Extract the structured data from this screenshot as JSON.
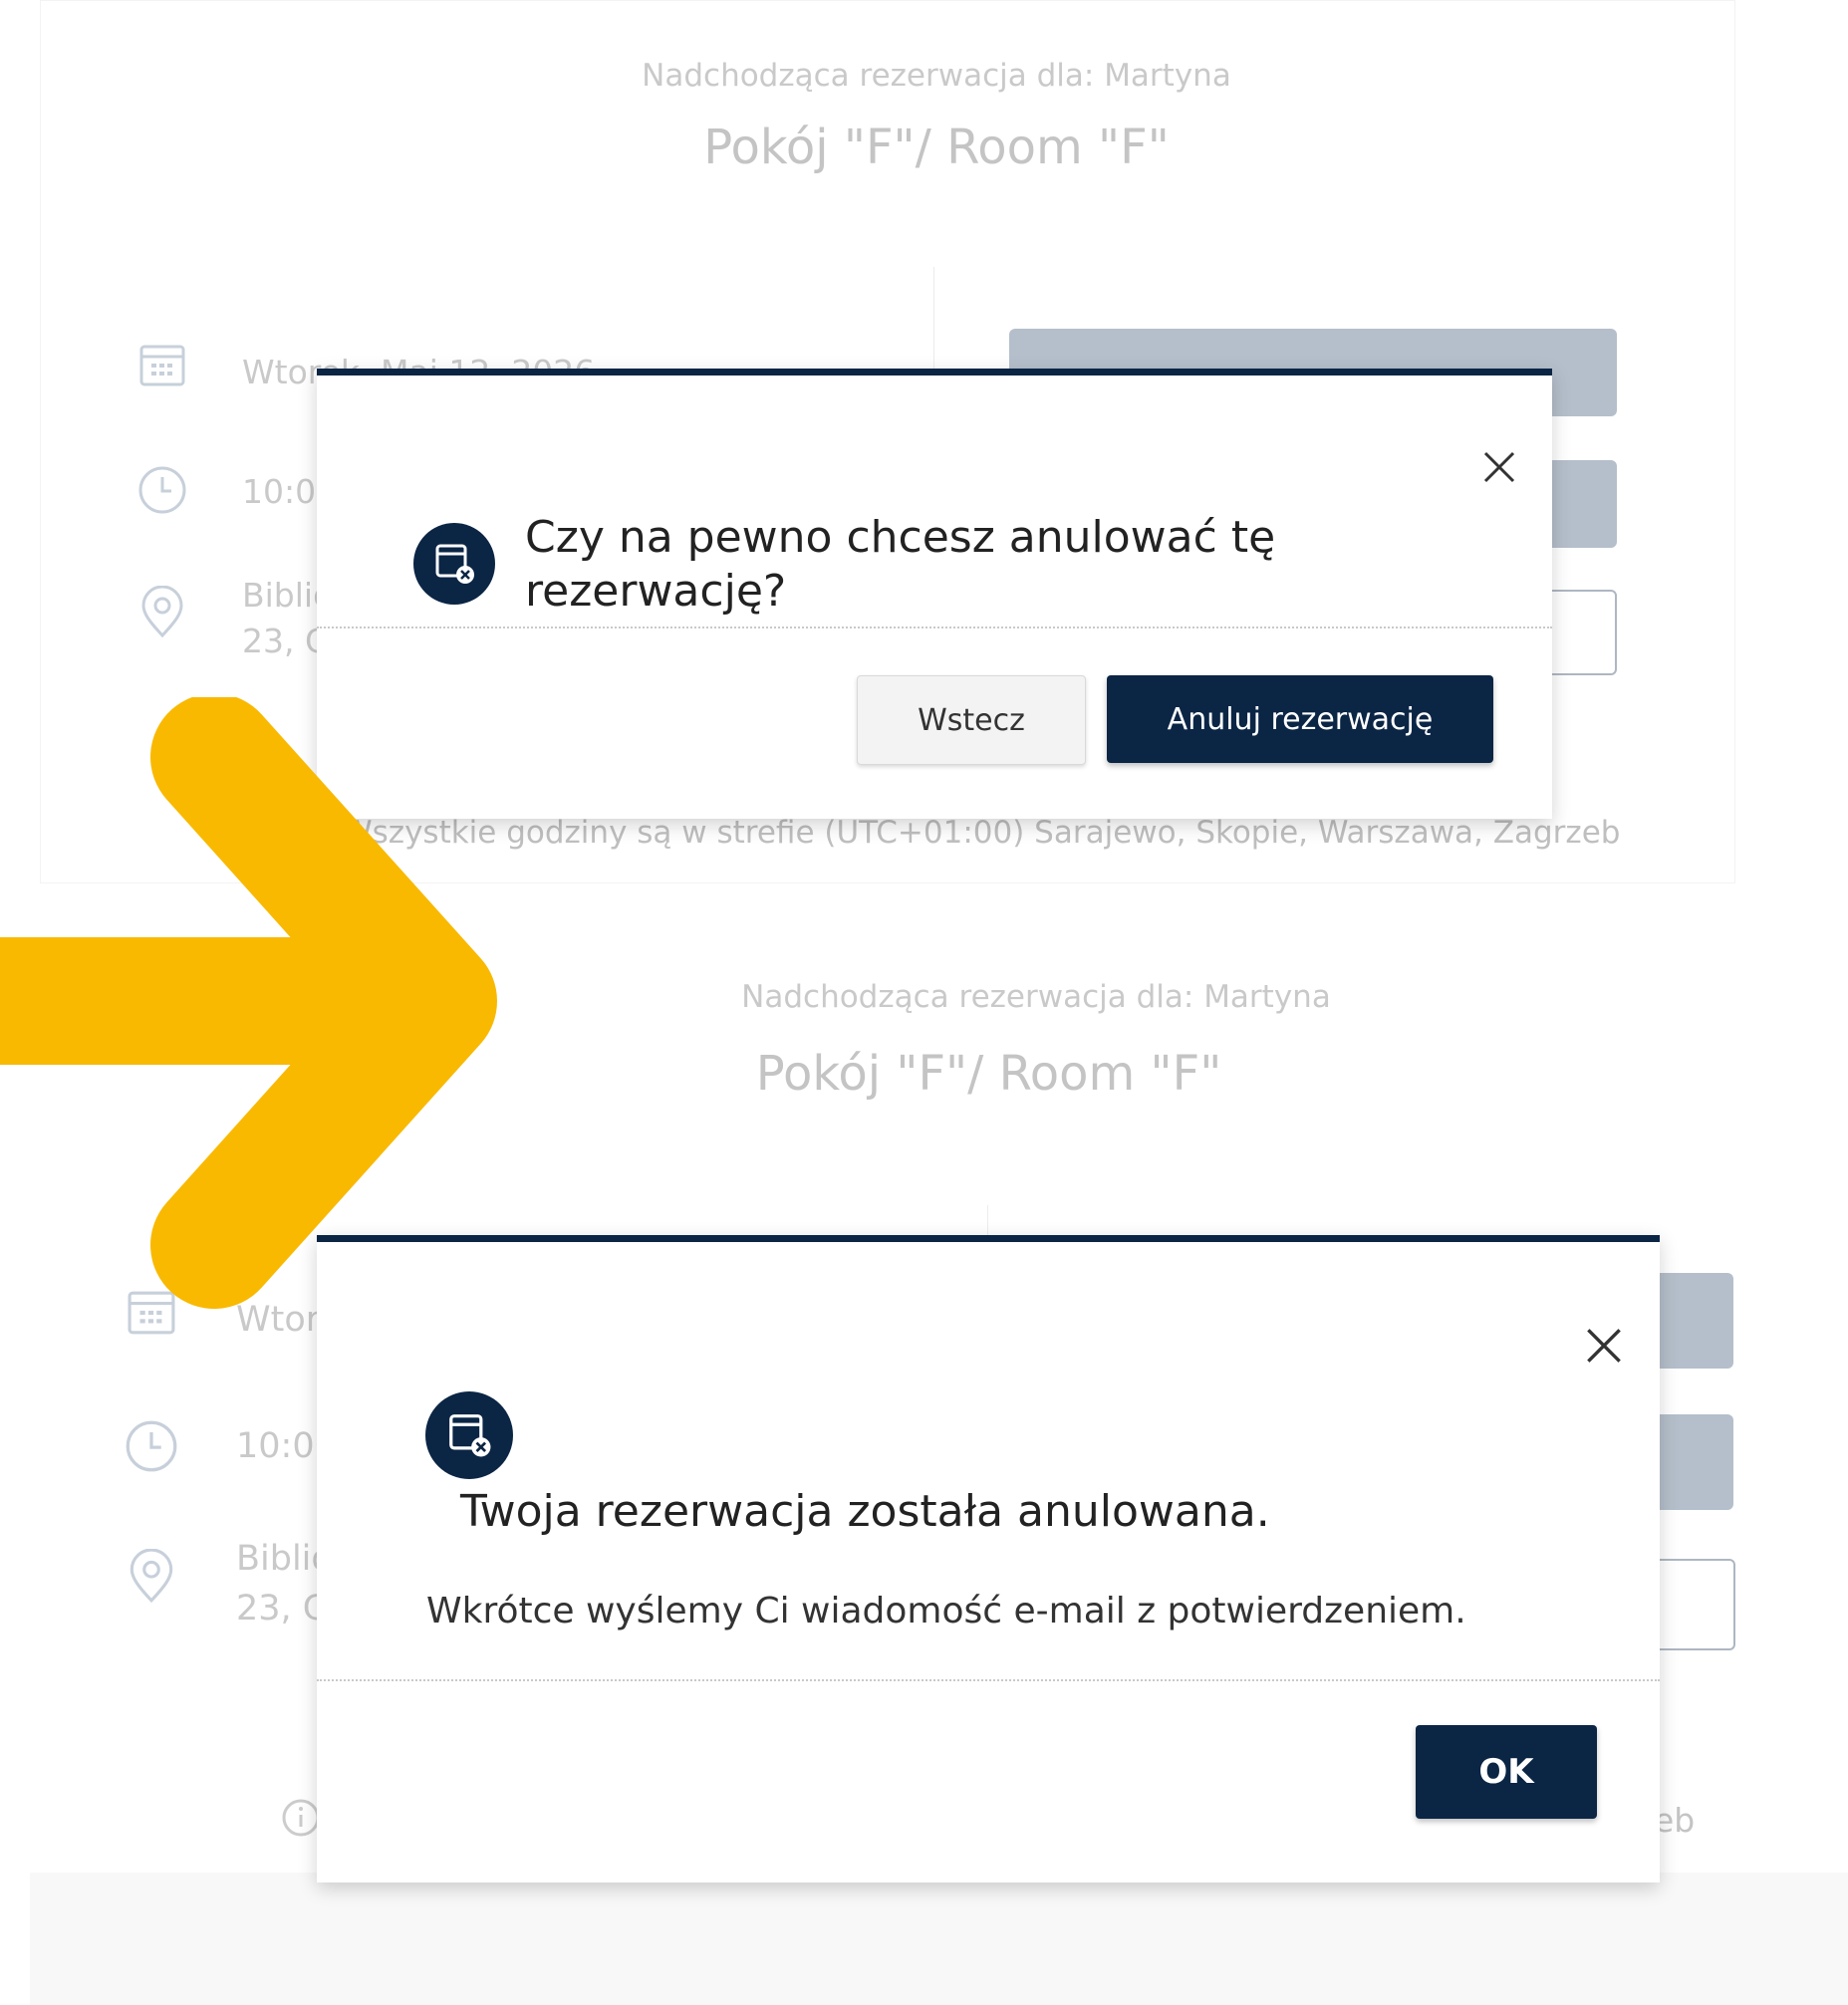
{
  "top_screen": {
    "upcoming_label": "Nadchodząca rezerwacja dla: Martyna",
    "room_title": "Pokój \"F\"/ Room \"F\"",
    "date_partial": "Wtorek, Maj 12, 2026",
    "time_partial": "10:00",
    "location_partial_line1": "Biblio",
    "location_partial_line2": "23, G",
    "timezone_note": "Wszystkie godziny są w strefie (UTC+01:00) Sarajewo, Skopie, Warszawa, Zagrzeb",
    "dialog": {
      "question": "Czy na pewno chcesz anulować tę rezerwację?",
      "back_label": "Wstecz",
      "confirm_label": "Anuluj rezerwację"
    }
  },
  "bottom_screen": {
    "upcoming_label": "Nadchodząca rezerwacja dla: Martyna",
    "room_title": "Pokój \"F\"/ Room \"F\"",
    "date_partial": "Wtor",
    "time_partial": "10:00",
    "location_partial_line1": "Biblio",
    "location_partial_line2": "23, G",
    "timezone_partial": "eb",
    "dialog": {
      "title": "Twoja rezerwacja została anulowana.",
      "message": "Wkrótce wyślemy Ci wiadomość e-mail z potwierdzeniem.",
      "ok_label": "OK"
    }
  },
  "icons": {
    "arrow_color": "#F9B900",
    "modal_accent": "#0B2545"
  }
}
